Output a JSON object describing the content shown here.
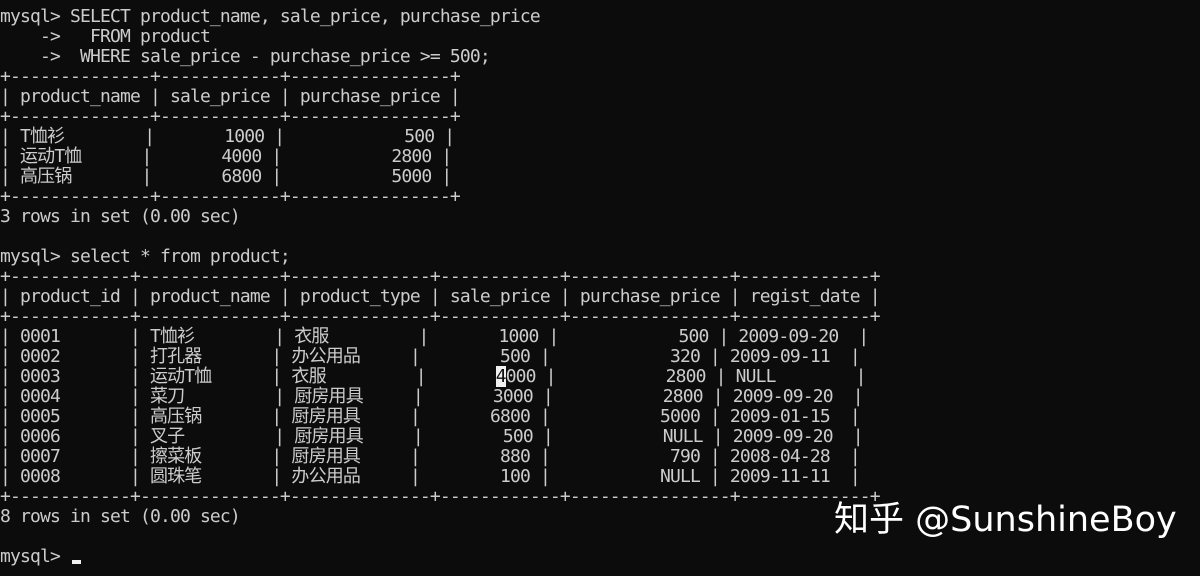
{
  "terminal": {
    "prompt": "mysql>",
    "lines": [
      "mysql> SELECT product_name, sale_price, purchase_price",
      "    ->   FROM product",
      "    ->  WHERE sale_price - purchase_price >= 500;",
      "+--------------+------------+----------------+",
      "| product_name | sale_price | purchase_price |",
      "+--------------+------------+----------------+",
      "| T恤衫        |       1000 |            500 |",
      "| 运动T恤      |       4000 |           2800 |",
      "| 高压锅       |       6800 |           5000 |",
      "+--------------+------------+----------------+",
      "3 rows in set (0.00 sec)",
      "",
      "mysql> select * from product;",
      "+------------+--------------+--------------+------------+----------------+-------------+",
      "| product_id | product_name | product_type | sale_price | purchase_price | regist_date |",
      "+------------+--------------+--------------+------------+----------------+-------------+",
      "| 0001       | T恤衫        | 衣服         |       1000 |            500 | 2009-09-20  |",
      "| 0002       | 打孔器       | 办公用品     |        500 |            320 | 2009-09-11  |",
      "| 0003       | 运动T恤      | 衣服         |       4000 |           2800 | NULL        |",
      "| 0004       | 菜刀         | 厨房用具     |       3000 |           2800 | 2009-09-20  |",
      "| 0005       | 高压锅       | 厨房用具     |       6800 |           5000 | 2009-01-15  |",
      "| 0006       | 叉子         | 厨房用具     |        500 |           NULL | 2009-09-20  |",
      "| 0007       | 擦菜板       | 厨房用具     |        880 |            790 | 2008-04-28  |",
      "| 0008       | 圆珠笔       | 办公用品     |        100 |           NULL | 2009-11-11  |",
      "+------------+--------------+--------------+------------+----------------+-------------+",
      "8 rows in set (0.00 sec)",
      ""
    ],
    "selection": {
      "line": 18,
      "text": "4"
    }
  },
  "watermark": {
    "text": "知乎 @SunshineBoy"
  },
  "colors": {
    "background": "#0c0c0c",
    "text": "#cccccc",
    "cursor": "#f0f0f0",
    "watermark": "#ffffff"
  }
}
